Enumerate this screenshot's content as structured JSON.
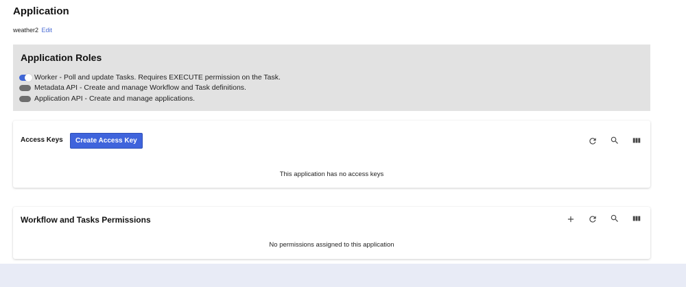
{
  "page": {
    "title": "Application",
    "app_name": "weather2",
    "edit_label": "Edit"
  },
  "roles": {
    "title": "Application Roles",
    "items": [
      {
        "label": "Worker - Poll and update Tasks. Requires EXECUTE permission on the Task.",
        "enabled": true
      },
      {
        "label": "Metadata API - Create and manage Workflow and Task definitions.",
        "enabled": false
      },
      {
        "label": "Application API - Create and manage applications.",
        "enabled": false
      }
    ]
  },
  "access_keys": {
    "title": "Access Keys",
    "create_label": "Create Access Key",
    "empty_message": "This application has no access keys",
    "icons": [
      "refresh-icon",
      "search-icon",
      "columns-icon"
    ]
  },
  "permissions": {
    "title": "Workflow and Tasks Permissions",
    "empty_message": "No permissions assigned to this application",
    "icons": [
      "add-icon",
      "refresh-icon",
      "search-icon",
      "columns-icon"
    ]
  },
  "colors": {
    "accent": "#3f64dc",
    "roles_panel_bg": "#e2e2e2",
    "footer_bg": "#e8ebf6"
  }
}
